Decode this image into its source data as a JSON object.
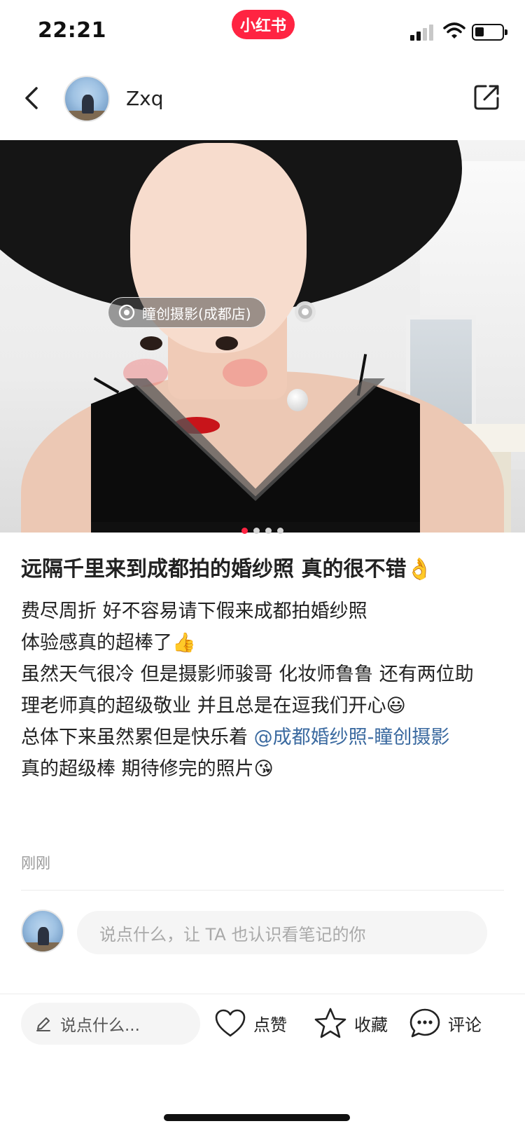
{
  "status_bar": {
    "time": "22:21",
    "app_badge": "小红书",
    "signal_icon": "cellular-signal-icon",
    "wifi_icon": "wifi-icon",
    "battery_icon": "battery-icon"
  },
  "header": {
    "back_icon": "back-chevron-icon",
    "username": "Zxq",
    "share_icon": "share-icon"
  },
  "photo": {
    "location_tag": "瞳创摄影(成都店)",
    "pin_icon": "location-pin-icon",
    "page_count": 4,
    "current_page": 1
  },
  "note": {
    "title": "远隔千里来到成都拍的婚纱照 真的很不错👌",
    "lines": [
      "费尽周折 好不容易请下假来成都拍婚纱照",
      "体验感真的超棒了👍",
      "虽然天气很冷 但是摄影师骏哥 化妆师鲁鲁 还有两位助理老师真的超级敬业 并且总是在逗我们开心😃",
      "总体下来虽然累但是快乐着",
      "真的超级棒  期待修完的照片😘"
    ],
    "mention": "@成都婚纱照-瞳创摄影",
    "timestamp": "刚刚"
  },
  "comment": {
    "placeholder": "说点什么，让 TA 也认识看笔记的你"
  },
  "bottom_bar": {
    "quick_input": "说点什么...",
    "like_label": "点赞",
    "collect_label": "收藏",
    "comment_label": "评论"
  },
  "colors": {
    "brand": "#ff2442",
    "mention": "#3b6aa0",
    "muted": "#999999"
  }
}
